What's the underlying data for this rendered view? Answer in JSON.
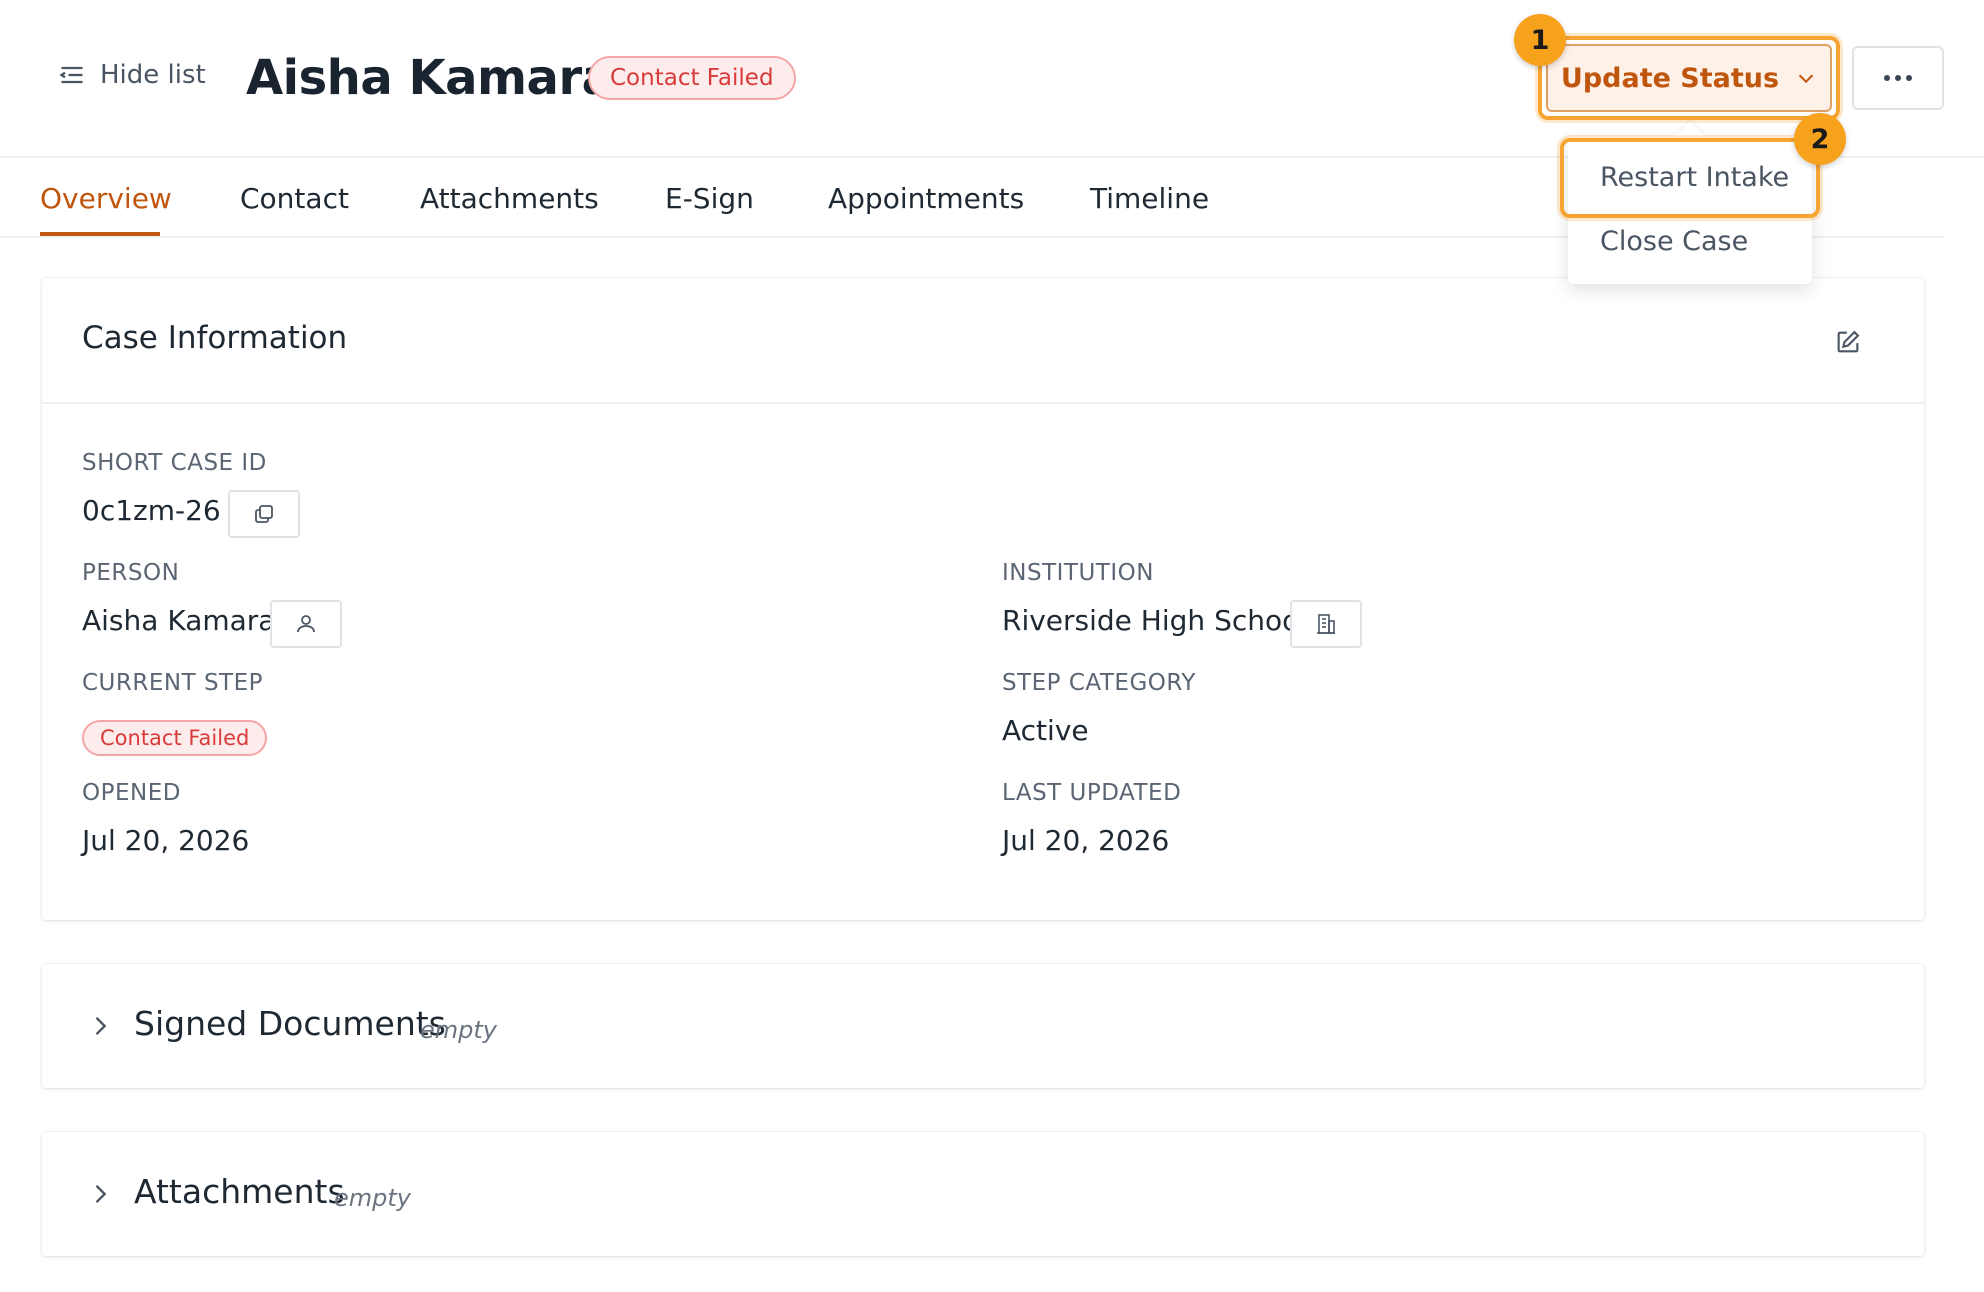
{
  "header": {
    "hide_list_label": "Hide list",
    "person_name": "Aisha Kamara",
    "status_badge": "Contact Failed",
    "update_status_label": "Update Status"
  },
  "markers": {
    "first": "1",
    "second": "2"
  },
  "dropdown": {
    "items": [
      {
        "label": "Restart Intake"
      },
      {
        "label": "Close Case"
      }
    ]
  },
  "tabs": [
    {
      "label": "Overview",
      "active": true
    },
    {
      "label": "Contact"
    },
    {
      "label": "Attachments"
    },
    {
      "label": "E-Sign"
    },
    {
      "label": "Appointments"
    },
    {
      "label": "Timeline"
    }
  ],
  "case_info": {
    "title": "Case Information",
    "short_case_id_label": "SHORT CASE ID",
    "short_case_id": "0c1zm-26",
    "person_label": "PERSON",
    "person": "Aisha Kamara",
    "institution_label": "INSTITUTION",
    "institution": "Riverside High School",
    "current_step_label": "CURRENT STEP",
    "current_step": "Contact Failed",
    "step_category_label": "STEP CATEGORY",
    "step_category": "Active",
    "opened_label": "OPENED",
    "opened": "Jul 20, 2026",
    "last_updated_label": "LAST UPDATED",
    "last_updated": "Jul 20, 2026"
  },
  "sections": [
    {
      "title": "Signed Documents",
      "state": "empty"
    },
    {
      "title": "Attachments",
      "state": "empty"
    }
  ],
  "colors": {
    "accent": "#c0560e",
    "highlight": "#f6a433",
    "danger": "#d93a3a"
  }
}
